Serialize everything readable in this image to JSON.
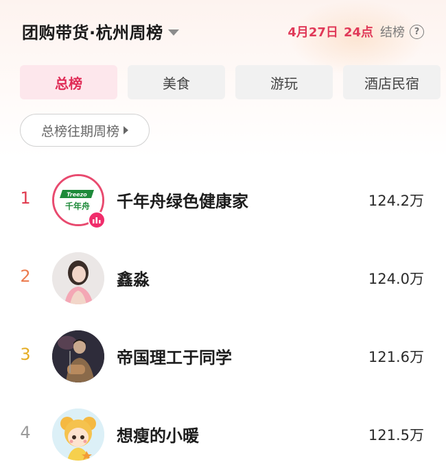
{
  "header": {
    "title": "团购带货·杭州周榜",
    "date": "4月27日",
    "time": "24点",
    "settle": "结榜",
    "help": "?"
  },
  "tabs": [
    {
      "label": "总榜",
      "active": true
    },
    {
      "label": "美食",
      "active": false
    },
    {
      "label": "游玩",
      "active": false
    },
    {
      "label": "酒店民宿",
      "active": false
    }
  ],
  "history_button": "总榜往期周榜",
  "rankings": [
    {
      "rank": "1",
      "name": "千年舟绿色健康家",
      "value": "124.2万",
      "rank_color": "#e03a4e",
      "logo_top": "Treezo",
      "logo_cn": "千年舟"
    },
    {
      "rank": "2",
      "name": "鑫淼",
      "value": "124.0万",
      "rank_color": "#ec7b4e"
    },
    {
      "rank": "3",
      "name": "帝国理工于同学",
      "value": "121.6万",
      "rank_color": "#e5ad24"
    },
    {
      "rank": "4",
      "name": "想瘦的小暖",
      "value": "121.5万",
      "rank_color": "#9a9a9a"
    }
  ]
}
